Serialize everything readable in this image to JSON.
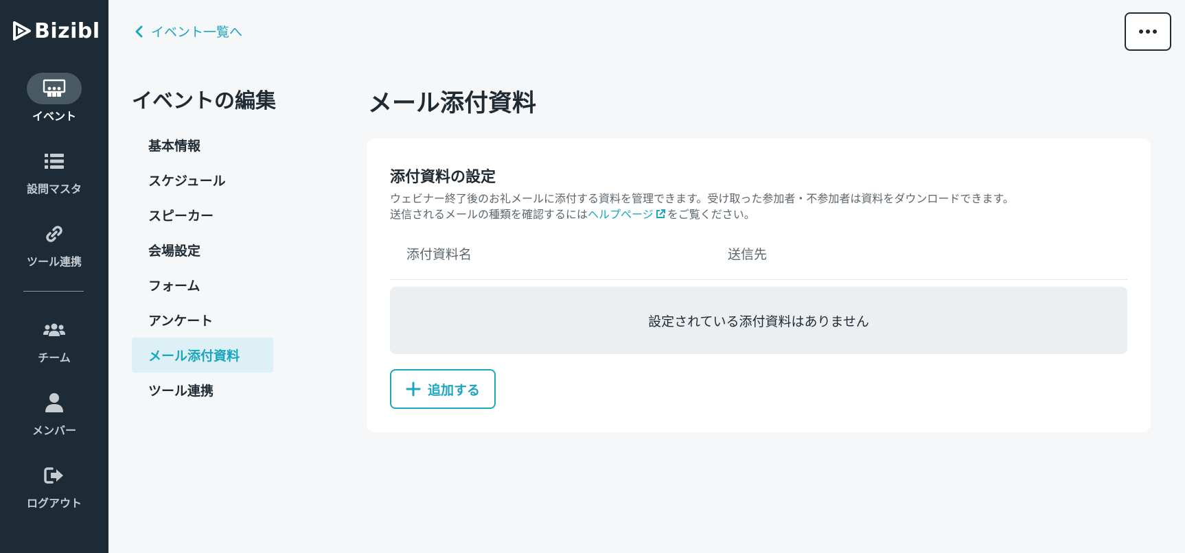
{
  "app": {
    "logo_text": "Bizibl"
  },
  "sidebar": {
    "items": [
      {
        "label": "イベント",
        "icon": "event-presentation-icon",
        "active": true
      },
      {
        "label": "設問マスタ",
        "icon": "list-icon",
        "active": false
      },
      {
        "label": "ツール連携",
        "icon": "link-icon",
        "active": false
      },
      {
        "label": "チーム",
        "icon": "team-icon",
        "active": false
      },
      {
        "label": "メンバー",
        "icon": "user-icon",
        "active": false
      },
      {
        "label": "ログアウト",
        "icon": "logout-icon",
        "active": false
      }
    ]
  },
  "header": {
    "back_label": "イベント一覧へ"
  },
  "section_nav": {
    "title": "イベントの編集",
    "items": [
      {
        "label": "基本情報",
        "active": false
      },
      {
        "label": "スケジュール",
        "active": false
      },
      {
        "label": "スピーカー",
        "active": false
      },
      {
        "label": "会場設定",
        "active": false
      },
      {
        "label": "フォーム",
        "active": false
      },
      {
        "label": "アンケート",
        "active": false
      },
      {
        "label": "メール添付資料",
        "active": true
      },
      {
        "label": "ツール連携",
        "active": false
      }
    ]
  },
  "main": {
    "title": "メール添付資料",
    "card": {
      "heading": "添付資料の設定",
      "desc_line1": "ウェビナー終了後のお礼メールに添付する資料を管理できます。受け取った参加者・不参加者は資料をダウンロードできます。",
      "desc_line2_prefix": "送信されるメールの種類を確認するには",
      "help_link": "ヘルプページ",
      "desc_line2_suffix": "をご覧ください。",
      "table": {
        "col_name": "添付資料名",
        "col_dest": "送信先",
        "empty_message": "設定されている添付資料はありません"
      },
      "add_label": "追加する"
    }
  },
  "colors": {
    "sidebar_bg": "#1c2b35",
    "accent": "#1ba6c0",
    "page_bg": "#f6f7f9"
  }
}
